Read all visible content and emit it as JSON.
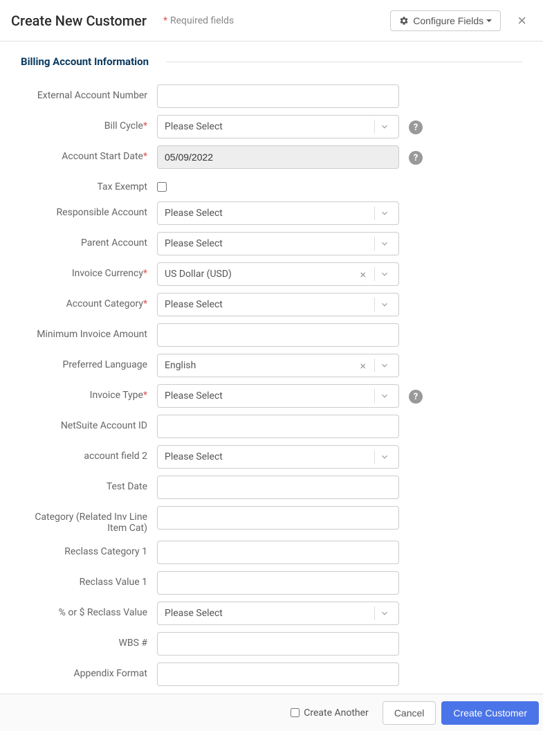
{
  "header": {
    "title": "Create New Customer",
    "required_note": "Required fields",
    "configure_label": "Configure Fields"
  },
  "section": {
    "title": "Billing Account Information"
  },
  "labels": {
    "external_account_number": "External Account Number",
    "bill_cycle": "Bill Cycle",
    "account_start_date": "Account Start Date",
    "tax_exempt": "Tax Exempt",
    "responsible_account": "Responsible Account",
    "parent_account": "Parent Account",
    "invoice_currency": "Invoice Currency",
    "account_category": "Account Category",
    "minimum_invoice_amount": "Minimum Invoice Amount",
    "preferred_language": "Preferred Language",
    "invoice_type": "Invoice Type",
    "netsuite_account_id": "NetSuite Account ID",
    "account_field_2": "account field 2",
    "test_date": "Test Date",
    "category_related": "Category (Related Inv Line Item Cat)",
    "reclass_category_1": "Reclass Category 1",
    "reclass_value_1": "Reclass Value 1",
    "percent_dollar_reclass": "% or $ Reclass Value",
    "wbs_num": "WBS #",
    "appendix_format": "Appendix Format"
  },
  "values": {
    "please_select": "Please Select",
    "account_start_date": "05/09/2022",
    "invoice_currency": "US Dollar (USD)",
    "preferred_language": "English",
    "external_account_number": "",
    "minimum_invoice_amount": "",
    "netsuite_account_id": "",
    "test_date": "",
    "category_related": "",
    "reclass_category_1": "",
    "reclass_value_1": "",
    "wbs_num": "",
    "appendix_format": ""
  },
  "footer": {
    "create_another": "Create Another",
    "cancel": "Cancel",
    "create_customer": "Create Customer"
  }
}
